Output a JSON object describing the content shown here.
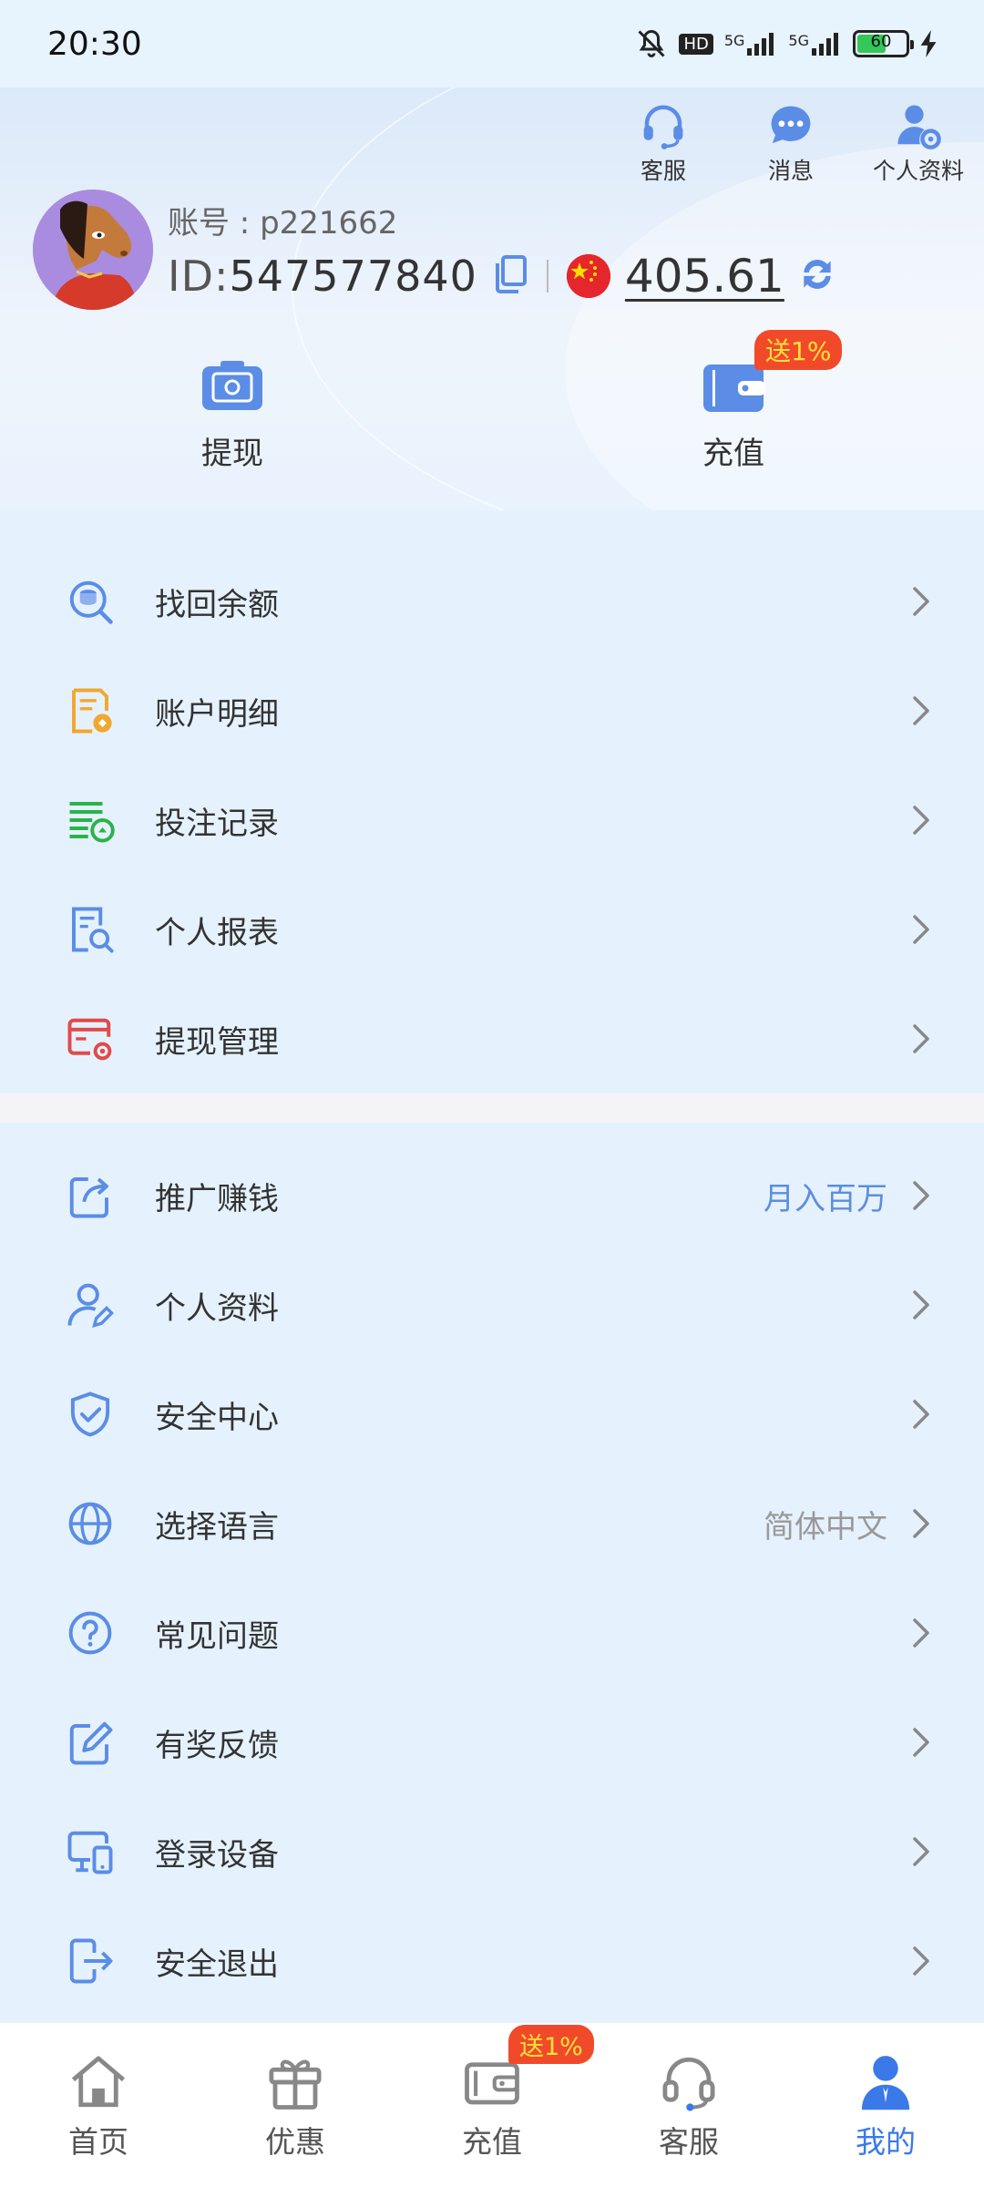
{
  "status_bar": {
    "time": "20:30",
    "network_1": "5G",
    "network_2": "5G",
    "hd": "HD",
    "battery": "60"
  },
  "header": {
    "actions": [
      {
        "label": "客服",
        "icon": "headset-icon"
      },
      {
        "label": "消息",
        "icon": "message-icon"
      },
      {
        "label": "个人资料",
        "icon": "profile-settings-icon"
      }
    ],
    "account_label": "账号 : p221662",
    "id_label": "ID:",
    "id_value": "547577840",
    "balance": "405.61"
  },
  "quick_actions": {
    "withdraw_label": "提现",
    "deposit_label": "充值",
    "deposit_badge": "送1%"
  },
  "menu_group_1": [
    {
      "label": "找回余额",
      "icon": "coins-search-icon"
    },
    {
      "label": "账户明细",
      "icon": "account-detail-icon"
    },
    {
      "label": "投注记录",
      "icon": "bet-record-icon"
    },
    {
      "label": "个人报表",
      "icon": "report-search-icon"
    },
    {
      "label": "提现管理",
      "icon": "withdraw-manage-icon"
    }
  ],
  "menu_group_2": [
    {
      "label": "推广赚钱",
      "icon": "share-icon",
      "extra": "月入百万"
    },
    {
      "label": "个人资料",
      "icon": "user-edit-icon",
      "extra": ""
    },
    {
      "label": "安全中心",
      "icon": "shield-check-icon",
      "extra": ""
    },
    {
      "label": "选择语言",
      "icon": "globe-icon",
      "extra": "简体中文"
    },
    {
      "label": "常见问题",
      "icon": "question-icon",
      "extra": ""
    },
    {
      "label": "有奖反馈",
      "icon": "edit-feedback-icon",
      "extra": ""
    },
    {
      "label": "登录设备",
      "icon": "devices-icon",
      "extra": ""
    },
    {
      "label": "安全退出",
      "icon": "logout-icon",
      "extra": ""
    }
  ],
  "tabbar": {
    "tabs": [
      {
        "label": "首页",
        "icon": "home-icon"
      },
      {
        "label": "优惠",
        "icon": "gift-icon"
      },
      {
        "label": "充值",
        "icon": "wallet-icon"
      },
      {
        "label": "客服",
        "icon": "headset-icon"
      },
      {
        "label": "我的",
        "icon": "user-icon"
      }
    ],
    "deposit_badge": "送1%",
    "active_index": 4
  },
  "colors": {
    "accent": "#3b79e8",
    "icon_blue": "#5b8de6",
    "badge_red": "#f14a2a",
    "badge_text": "#ffe03a",
    "extra_blue": "#5c8de0",
    "extra_gray": "#999999"
  }
}
